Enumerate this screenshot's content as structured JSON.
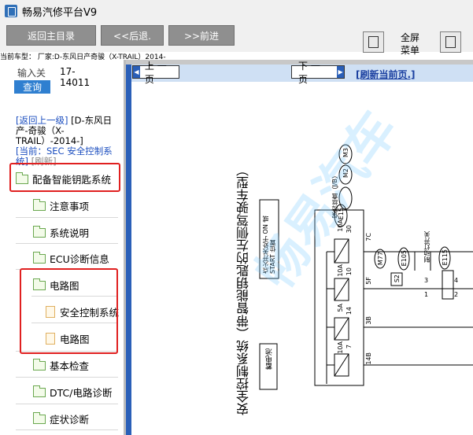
{
  "app": {
    "title": "畅易汽修平台V9"
  },
  "toolbar": {
    "home_label": "返回主目录",
    "back_label": "<<后退.",
    "forward_label": ">>前进",
    "fullscreen_label_1": "全屏",
    "fullscreen_label_2": "菜单"
  },
  "vehicle": {
    "text": "当前车型： 厂家:D-东风日产奇骏（X-TRAIL）2014-"
  },
  "search": {
    "label": "输入关",
    "button": "查询",
    "value_1": "17-",
    "value_2": "14011"
  },
  "nav": {
    "back_link": "[返回上一级]",
    "parent": "[D-东风日产-奇骏（X-TRAIL）-2014-]",
    "current": "[当前：SEC 安全控制系统]",
    "refresh": "[刷新]"
  },
  "tree": {
    "items": [
      {
        "label": "配备智能钥匙系统"
      },
      {
        "label": "注意事项"
      },
      {
        "label": "系统说明"
      },
      {
        "label": "ECU诊断信息"
      },
      {
        "label": "电路图"
      },
      {
        "label": "安全控制系统"
      },
      {
        "label": "电路图"
      },
      {
        "label": "基本检查"
      },
      {
        "label": "DTC/电路诊断"
      },
      {
        "label": "症状诊断"
      }
    ]
  },
  "pager": {
    "prev": "上 一 页",
    "next": "下 一 页",
    "refresh": "[刷新当前页.]"
  },
  "diagram": {
    "title": "安全控制系统（带智能钥匙的左侧驾驶车型）",
    "watermark": "畅易汽车",
    "battery": "蓄电池",
    "ignition": "点火开关处于 ON 或 START 位置",
    "fuse_box": "保险丝盒（J/B）",
    "fuse_1": "10A",
    "fuse_1_no": "30",
    "fuse_2": "10A",
    "fuse_2_no": "10",
    "fuse_3": "5A",
    "fuse_3_no": "14",
    "fuse_4": "10A",
    "fuse_4_no": "7",
    "wire_1": "7C",
    "wire_2": "5F",
    "wire_3": "3B",
    "wire_4": "14B",
    "conn_e15": "E15",
    "conn_m2": "M2",
    "conn_m3": "M3",
    "conn_m77": "M77",
    "conn_e105": "E105",
    "conn_s2": "S2",
    "conn_e115": "E115",
    "brake_switch": "制动灯开关",
    "pin_1": "1",
    "pin_2": "2",
    "pin_3": "3",
    "pin_4": "4"
  },
  "colors": {
    "accent": "#2f7fd0",
    "highlight": "#e02020",
    "nav_bg": "#cfe0f4"
  }
}
